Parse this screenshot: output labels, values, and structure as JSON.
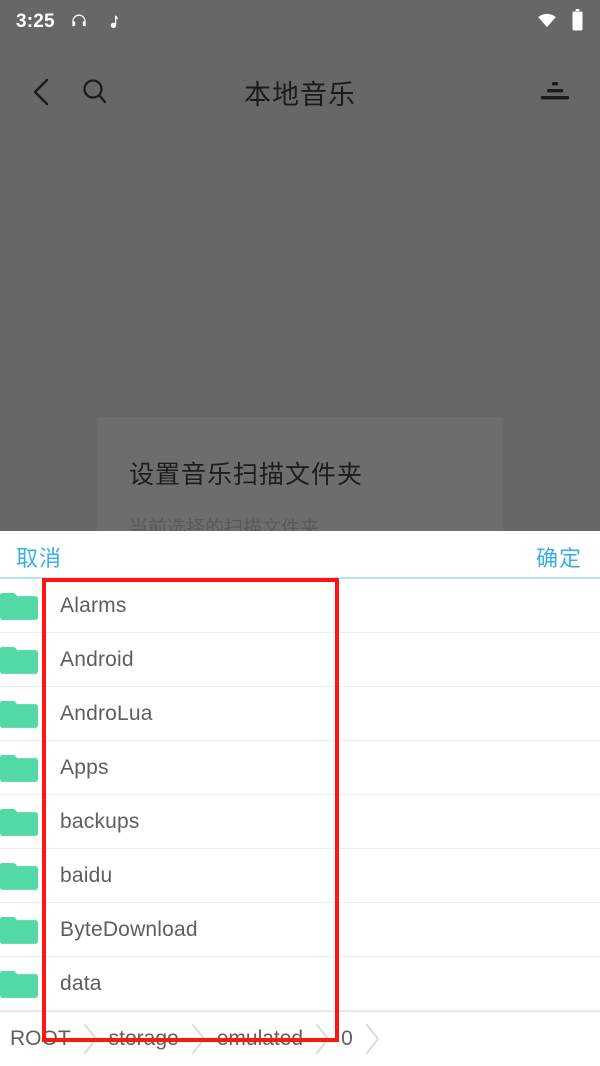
{
  "statusbar": {
    "time": "3:25",
    "left_icons": [
      "headphones-icon",
      "music-note-icon"
    ],
    "right_icons": [
      "wifi-icon",
      "battery-icon"
    ],
    "foreground_color": "#ffffff"
  },
  "toolbar": {
    "title": "本地音乐",
    "back_icon": "back-chevron-icon",
    "search_icon": "search-icon",
    "sort_icon": "sort-icon"
  },
  "background_dialog": {
    "title": "设置音乐扫描文件夹",
    "subtitle": "当前选择的扫描文件夹"
  },
  "sheet": {
    "cancel_label": "取消",
    "confirm_label": "确定",
    "accent_color": "#3aaee8",
    "divider_color": "#b6e3f7",
    "folder_icon_color": "#53d9a5",
    "items": [
      {
        "name": "Alarms",
        "icon": "folder-icon"
      },
      {
        "name": "Android",
        "icon": "folder-icon"
      },
      {
        "name": "AndroLua",
        "icon": "folder-icon"
      },
      {
        "name": "Apps",
        "icon": "folder-icon"
      },
      {
        "name": "backups",
        "icon": "folder-icon"
      },
      {
        "name": "baidu",
        "icon": "folder-icon"
      },
      {
        "name": "ByteDownload",
        "icon": "folder-icon"
      },
      {
        "name": "data",
        "icon": "folder-icon"
      }
    ]
  },
  "breadcrumb": {
    "separator_icon": "chevron-right-icon",
    "items": [
      "ROOT",
      "storage",
      "emulated",
      "0"
    ]
  },
  "annotation": {
    "color": "#fe1712",
    "shape": "rectangle"
  },
  "scrim_color": "#676767"
}
